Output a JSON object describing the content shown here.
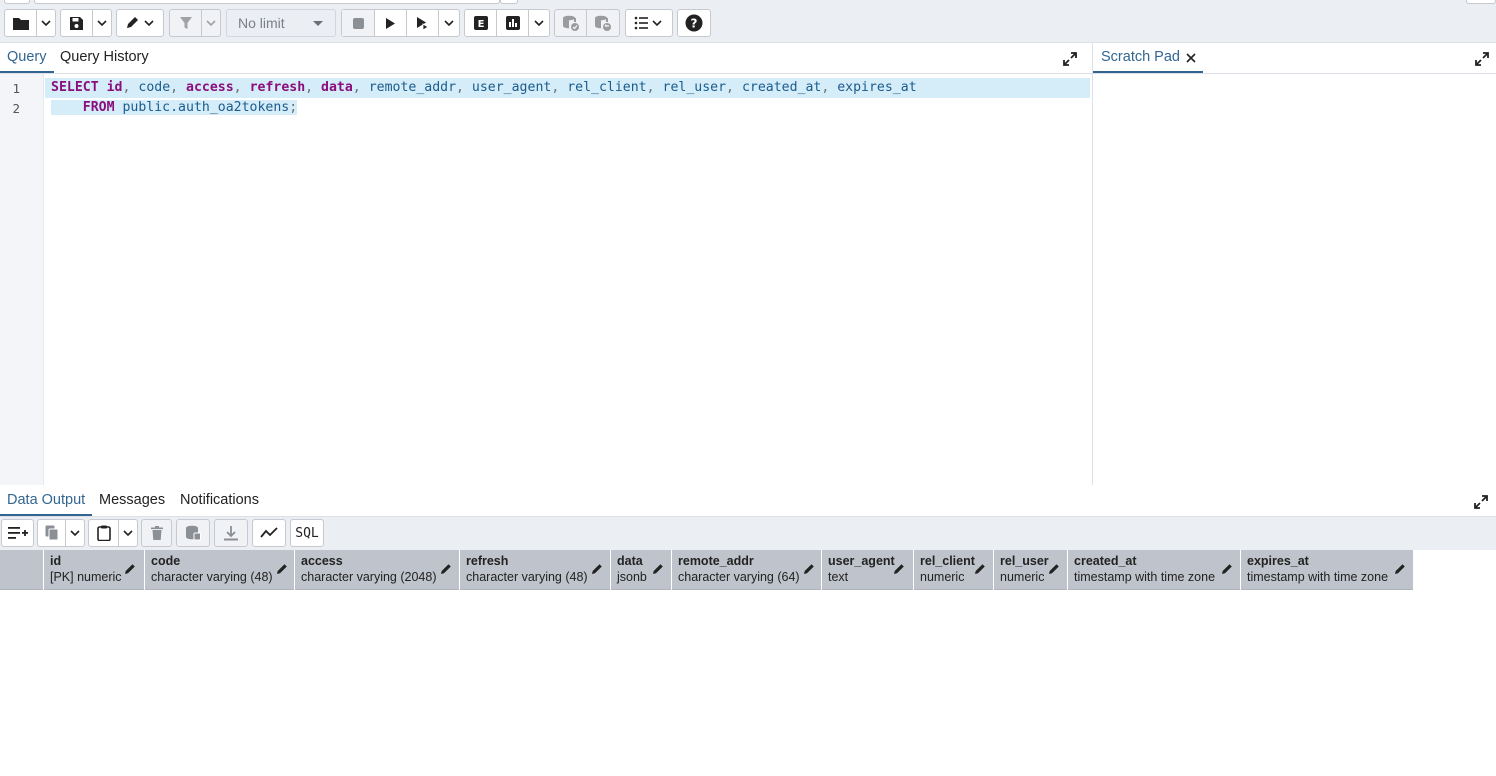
{
  "toolbar": {
    "limit_label": "No limit",
    "sql_label": "SQL"
  },
  "query_tabs": [
    {
      "label": "Query",
      "active": true
    },
    {
      "label": "Query History",
      "active": false
    }
  ],
  "scratch_pad": {
    "label": "Scratch Pad"
  },
  "editor": {
    "line_numbers": [
      "1",
      "2"
    ],
    "line1": {
      "select": "SELECT",
      "c1": "id",
      "c2": "code",
      "c3": "access",
      "c4": "refresh",
      "c5": "data",
      "c6": "remote_addr",
      "c7": "user_agent",
      "c8": "rel_client",
      "c9": "rel_user",
      "c10": "created_at",
      "c11": "expires_at"
    },
    "line2": {
      "from": "FROM",
      "table": "public.auth_oa2tokens",
      "end": ";"
    }
  },
  "output_tabs": [
    {
      "label": "Data Output",
      "active": true
    },
    {
      "label": "Messages",
      "active": false
    },
    {
      "label": "Notifications",
      "active": false
    }
  ],
  "columns": [
    {
      "name": "id",
      "type": "[PK] numeric"
    },
    {
      "name": "code",
      "type": "character varying (48)"
    },
    {
      "name": "access",
      "type": "character varying (2048)"
    },
    {
      "name": "refresh",
      "type": "character varying (48)"
    },
    {
      "name": "data",
      "type": "jsonb"
    },
    {
      "name": "remote_addr",
      "type": "character varying (64)"
    },
    {
      "name": "user_agent",
      "type": "text"
    },
    {
      "name": "rel_client",
      "type": "numeric"
    },
    {
      "name": "rel_user",
      "type": "numeric"
    },
    {
      "name": "created_at",
      "type": "timestamp with time zone"
    },
    {
      "name": "expires_at",
      "type": "timestamp with time zone"
    }
  ],
  "colors": {
    "accent": "#326690",
    "keyword": "#8a0e7c",
    "identifier": "#1b5c8c",
    "selection": "#d5ecf9"
  },
  "icons": [
    "folder-icon",
    "save-icon",
    "edit-icon",
    "filter-icon",
    "stop-icon",
    "play-icon",
    "play-step-icon",
    "explain-icon",
    "explain-analyze-icon",
    "commit-icon",
    "rollback-icon",
    "macros-icon",
    "help-icon",
    "expand-icon",
    "close-icon",
    "add-row-icon",
    "copy-icon",
    "paste-icon",
    "delete-icon",
    "save-data-icon",
    "download-icon",
    "graph-icon",
    "pen-icon"
  ]
}
